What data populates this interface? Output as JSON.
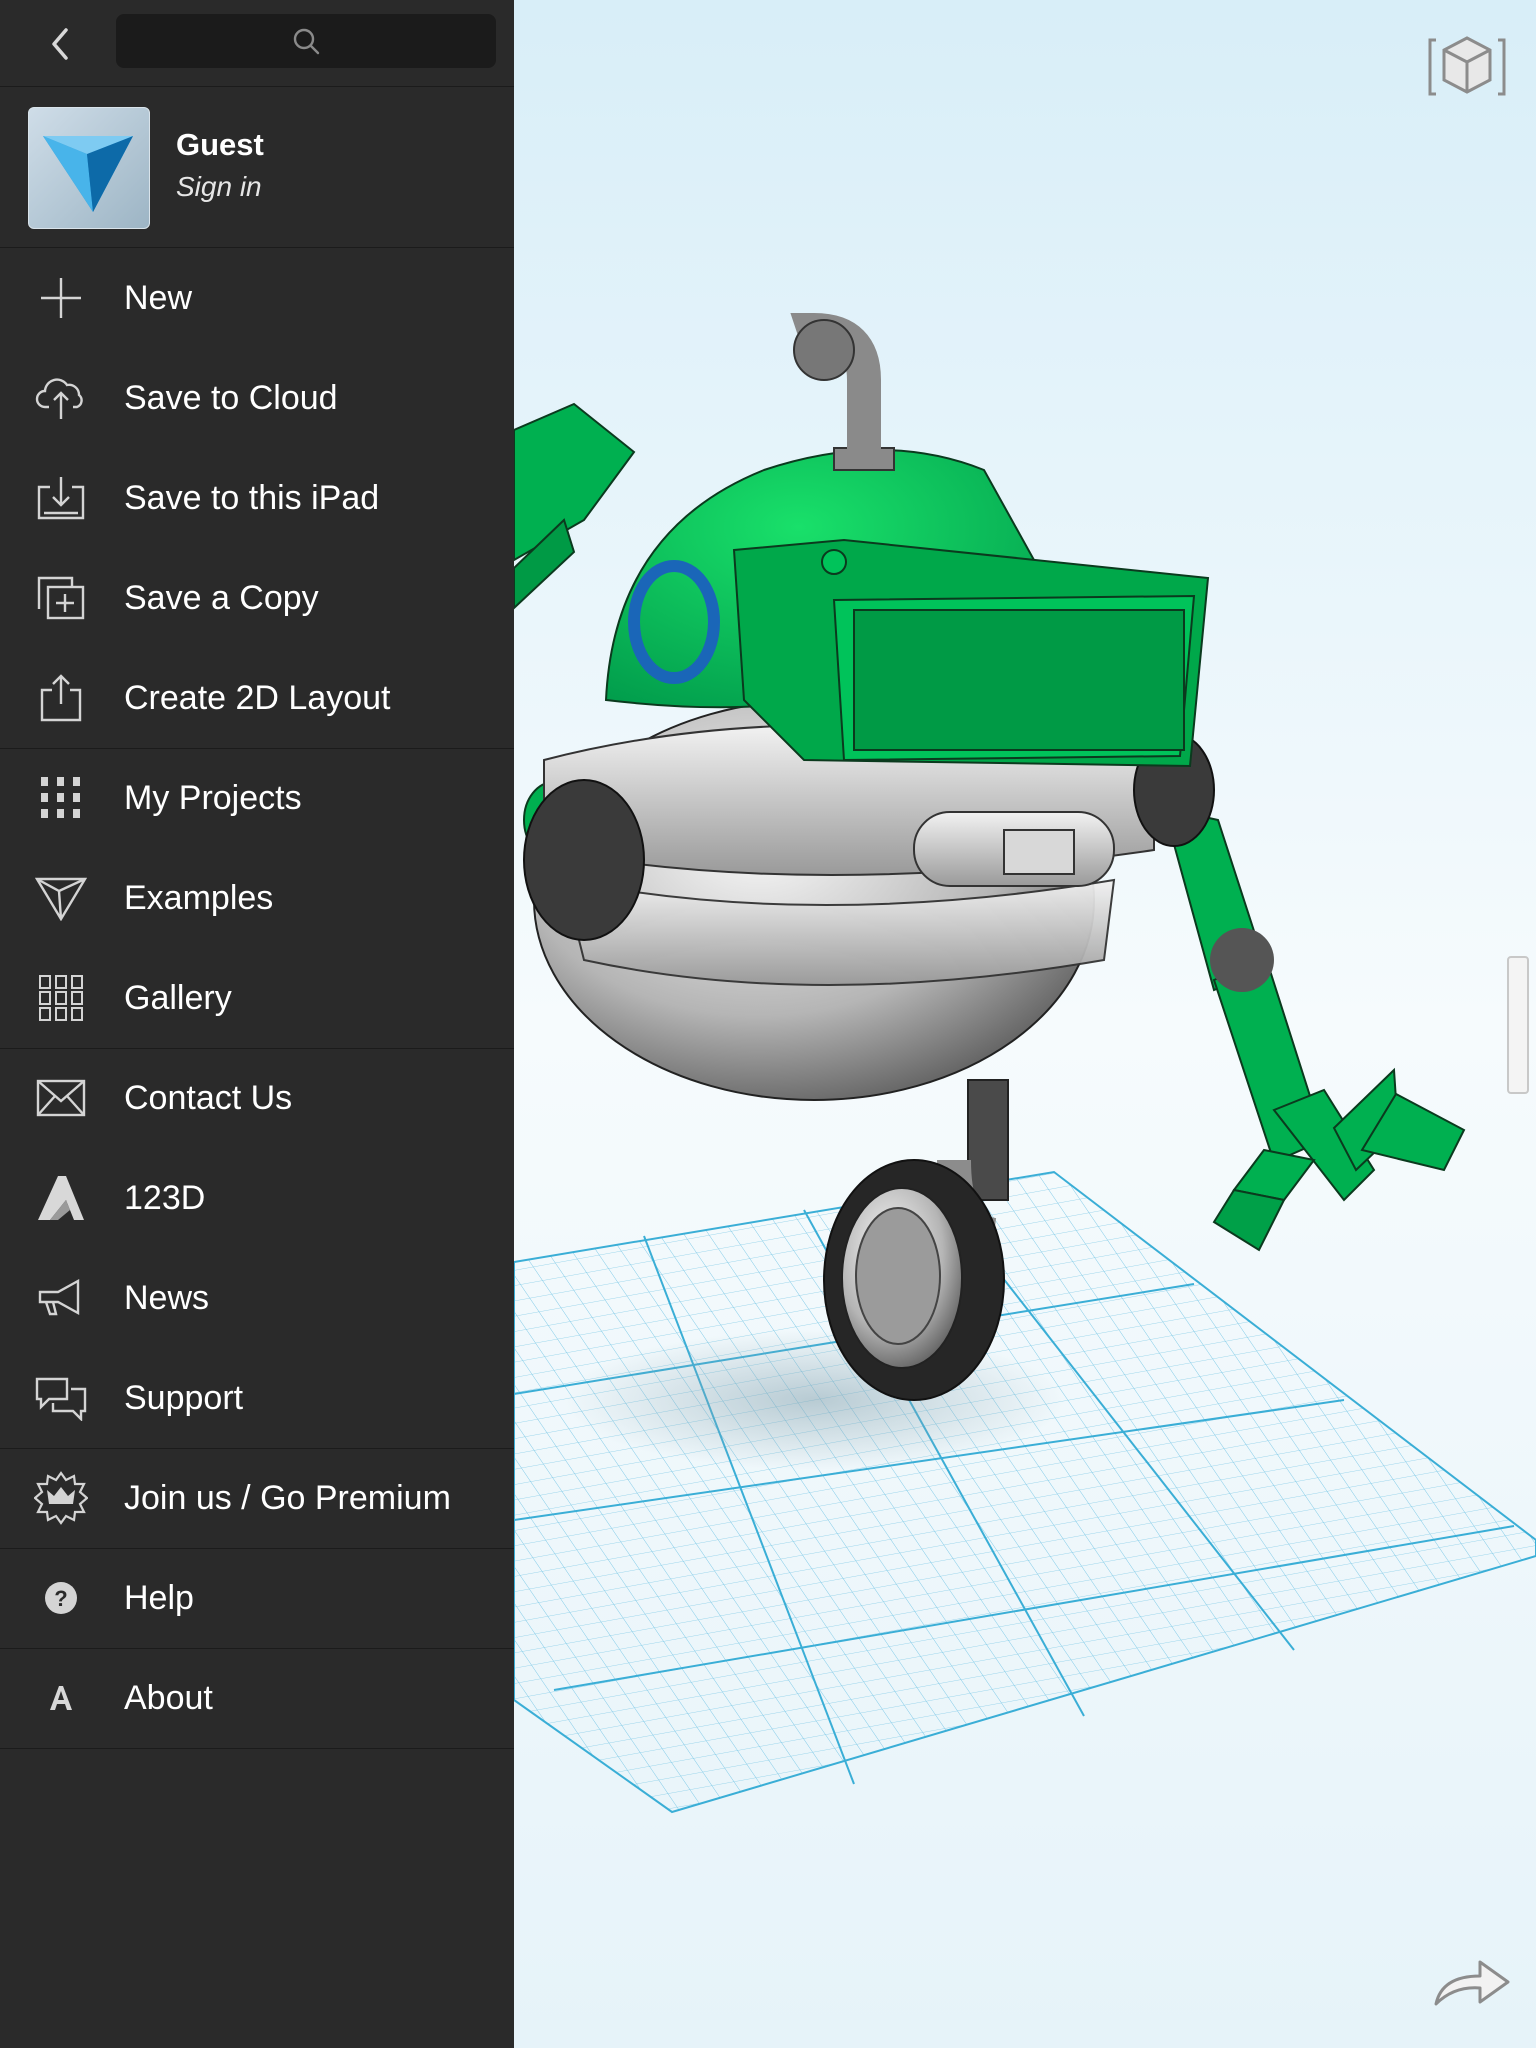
{
  "sidebar": {
    "user": {
      "name": "Guest",
      "sign_in": "Sign in"
    },
    "groups": [
      [
        {
          "label": "New",
          "icon": "plus-icon"
        },
        {
          "label": "Save to Cloud",
          "icon": "cloud-upload-icon"
        },
        {
          "label": "Save to this iPad",
          "icon": "download-tray-icon"
        },
        {
          "label": "Save a Copy",
          "icon": "copy-plus-icon"
        },
        {
          "label": "Create 2D Layout",
          "icon": "share-upload-icon"
        }
      ],
      [
        {
          "label": "My Projects",
          "icon": "grid-dots-icon"
        },
        {
          "label": "Examples",
          "icon": "triangle-icon"
        },
        {
          "label": "Gallery",
          "icon": "gallery-grid-icon"
        }
      ],
      [
        {
          "label": "Contact Us",
          "icon": "envelope-icon"
        },
        {
          "label": "123D",
          "icon": "autodesk-a-icon"
        },
        {
          "label": "News",
          "icon": "megaphone-icon"
        },
        {
          "label": "Support",
          "icon": "chat-bubbles-icon"
        }
      ],
      [
        {
          "label": "Join us / Go Premium",
          "icon": "crown-badge-icon"
        }
      ],
      [
        {
          "label": "Help",
          "icon": "question-circle-icon"
        }
      ],
      [
        {
          "label": "About",
          "icon": "letter-a-icon"
        }
      ]
    ]
  },
  "colors": {
    "sidebar_bg": "#2a2a2a",
    "model_green": "#00b050",
    "model_grey": "#b8b8b8",
    "grid_line": "#4fb3d9"
  }
}
